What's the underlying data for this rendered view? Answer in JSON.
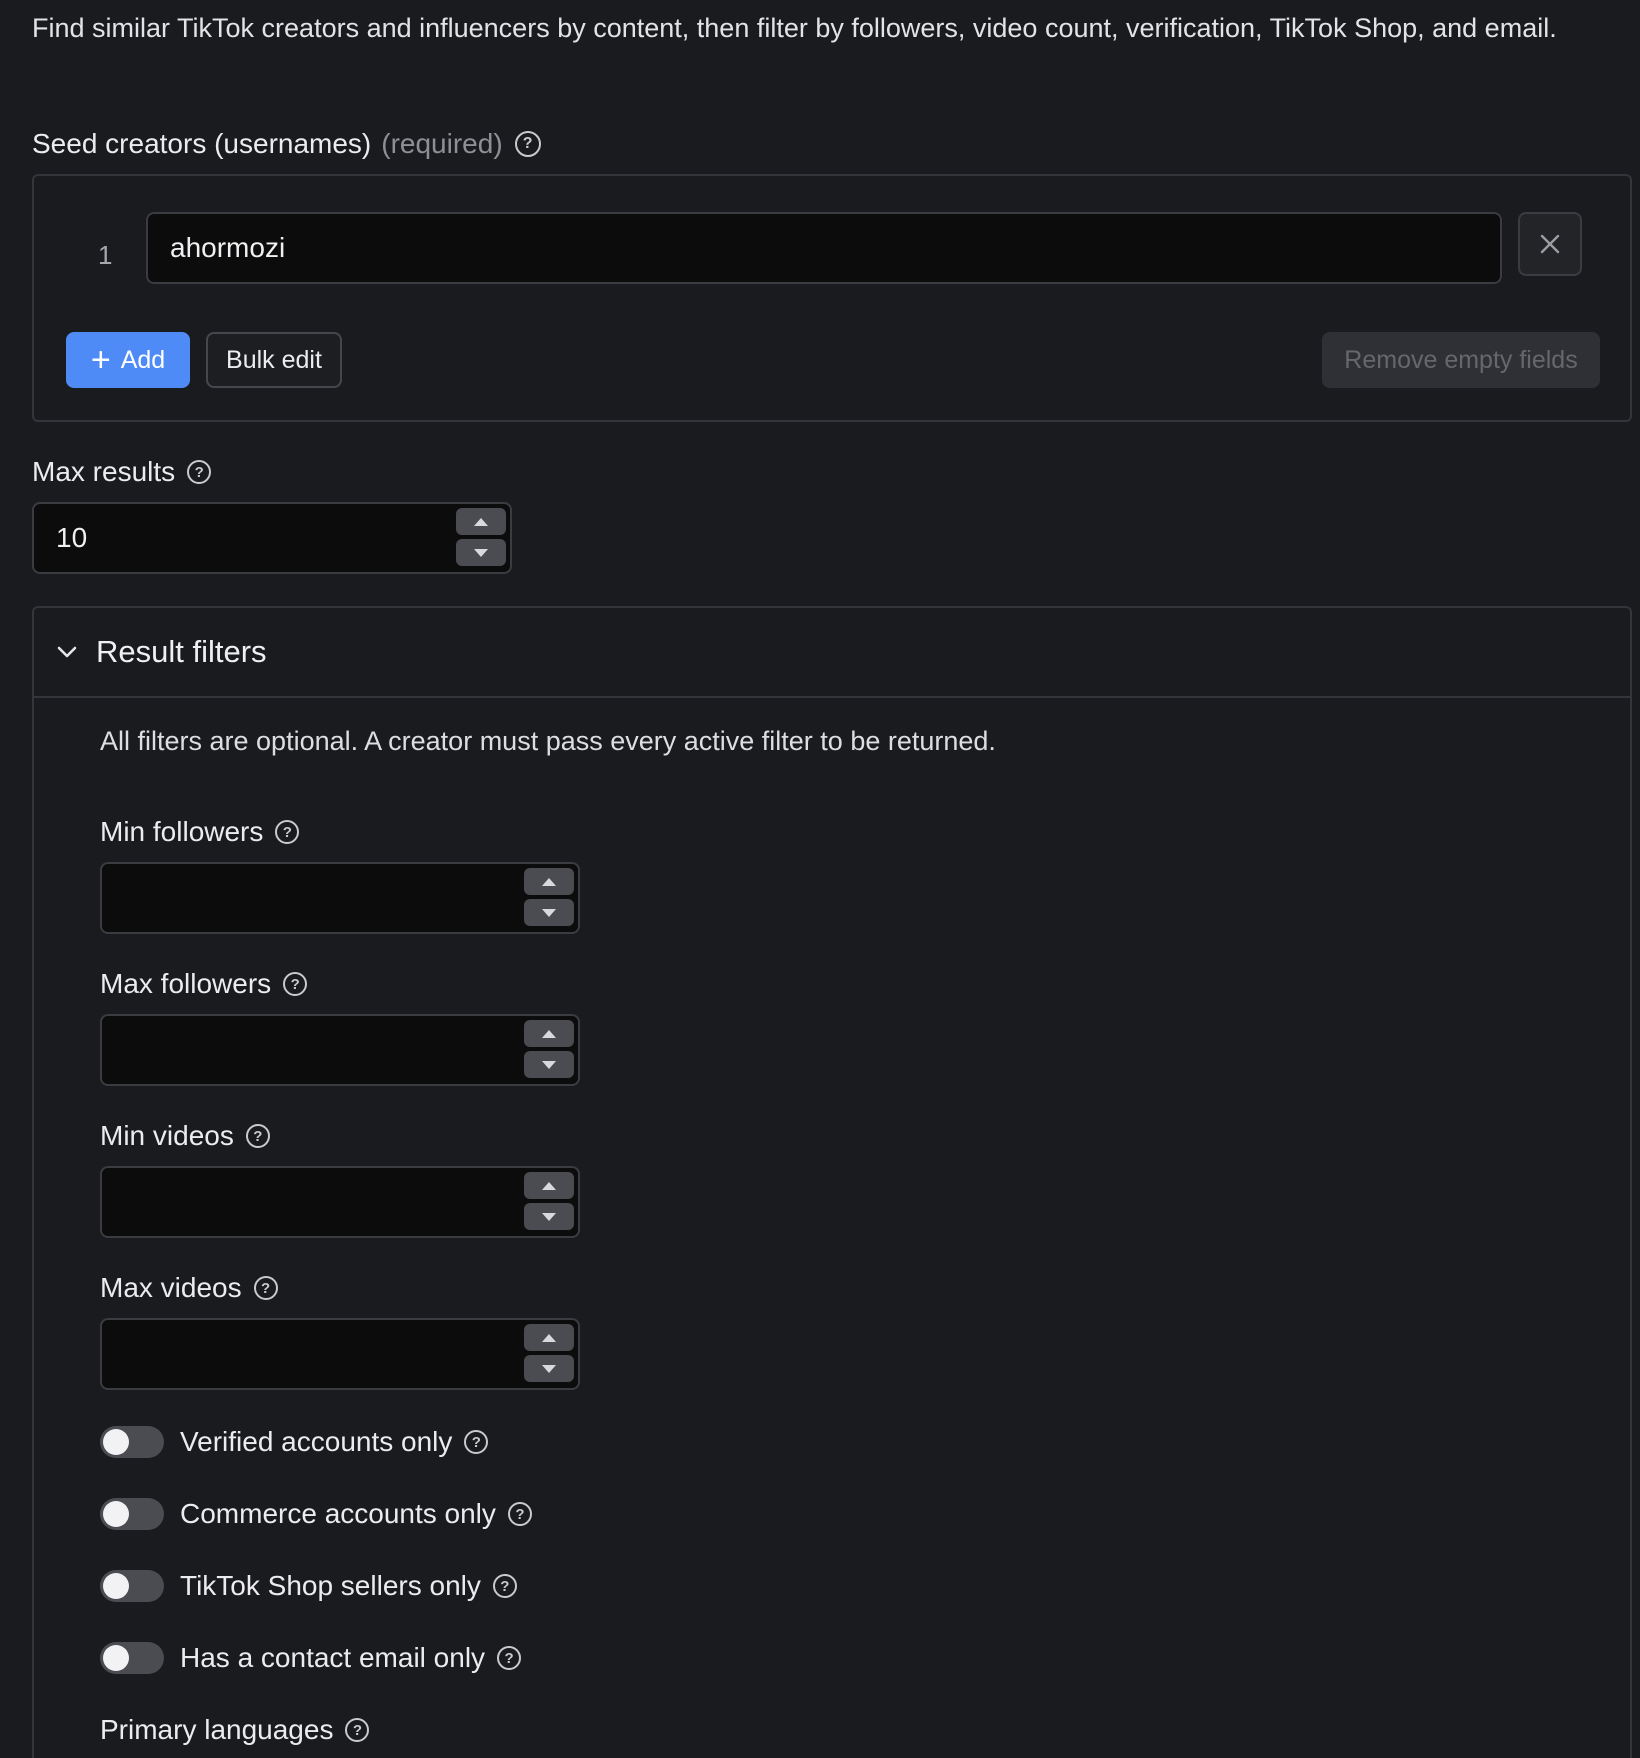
{
  "description": "Find similar TikTok creators and influencers by content, then filter by followers, video count, verification, TikTok Shop, and email.",
  "seed": {
    "label": "Seed creators (usernames)",
    "required": "(required)",
    "rows": [
      {
        "index": "1",
        "value": "ahormozi"
      }
    ],
    "add_label": "Add",
    "bulk_edit_label": "Bulk edit",
    "remove_empty_label": "Remove empty fields"
  },
  "max_results": {
    "label": "Max results",
    "value": "10"
  },
  "filters": {
    "title": "Result filters",
    "note": "All filters are optional. A creator must pass every active filter to be returned.",
    "min_followers": {
      "label": "Min followers",
      "value": ""
    },
    "max_followers": {
      "label": "Max followers",
      "value": ""
    },
    "min_videos": {
      "label": "Min videos",
      "value": ""
    },
    "max_videos": {
      "label": "Max videos",
      "value": ""
    },
    "toggles": [
      {
        "label": "Verified accounts only",
        "checked": false
      },
      {
        "label": "Commerce accounts only",
        "checked": false
      },
      {
        "label": "TikTok Shop sellers only",
        "checked": false
      },
      {
        "label": "Has a contact email only",
        "checked": false
      }
    ],
    "primary_languages": {
      "label": "Primary languages"
    }
  },
  "icons": {
    "help": "question-circle-icon",
    "close": "close-icon",
    "plus": "plus-icon",
    "chevron": "chevron-down-icon"
  },
  "colors": {
    "background": "#1a1b1e",
    "accent": "#4f8bf7",
    "input_bg": "#0c0c0d",
    "border": "#33353a"
  }
}
